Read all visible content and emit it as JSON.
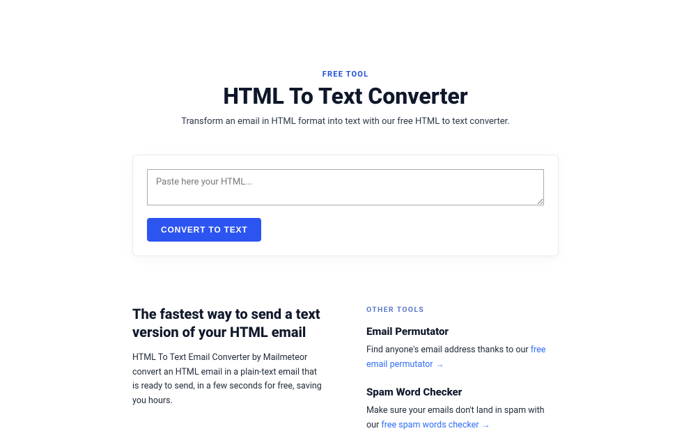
{
  "header": {
    "eyebrow": "FREE TOOL",
    "title": "HTML To Text Converter",
    "subtitle": "Transform an email in HTML format into text with our free HTML to text converter."
  },
  "converter": {
    "placeholder": "Paste here your HTML...",
    "button_label": "CONVERT TO TEXT"
  },
  "info": {
    "heading": "The fastest way to send a text version of your HTML email",
    "body": "HTML To Text Email Converter by Mailmeteor convert an HTML email in a plain-text email that is ready to send, in a few seconds for free, saving you hours."
  },
  "other_tools": {
    "eyebrow": "OTHER TOOLS",
    "tools": [
      {
        "title": "Email Permutator",
        "desc_prefix": "Find anyone's email address thanks to our ",
        "link_text": "free email permutator"
      },
      {
        "title": "Spam Word Checker",
        "desc_prefix": "Make sure your emails don't land in spam with our ",
        "link_text": "free spam words checker"
      }
    ]
  }
}
